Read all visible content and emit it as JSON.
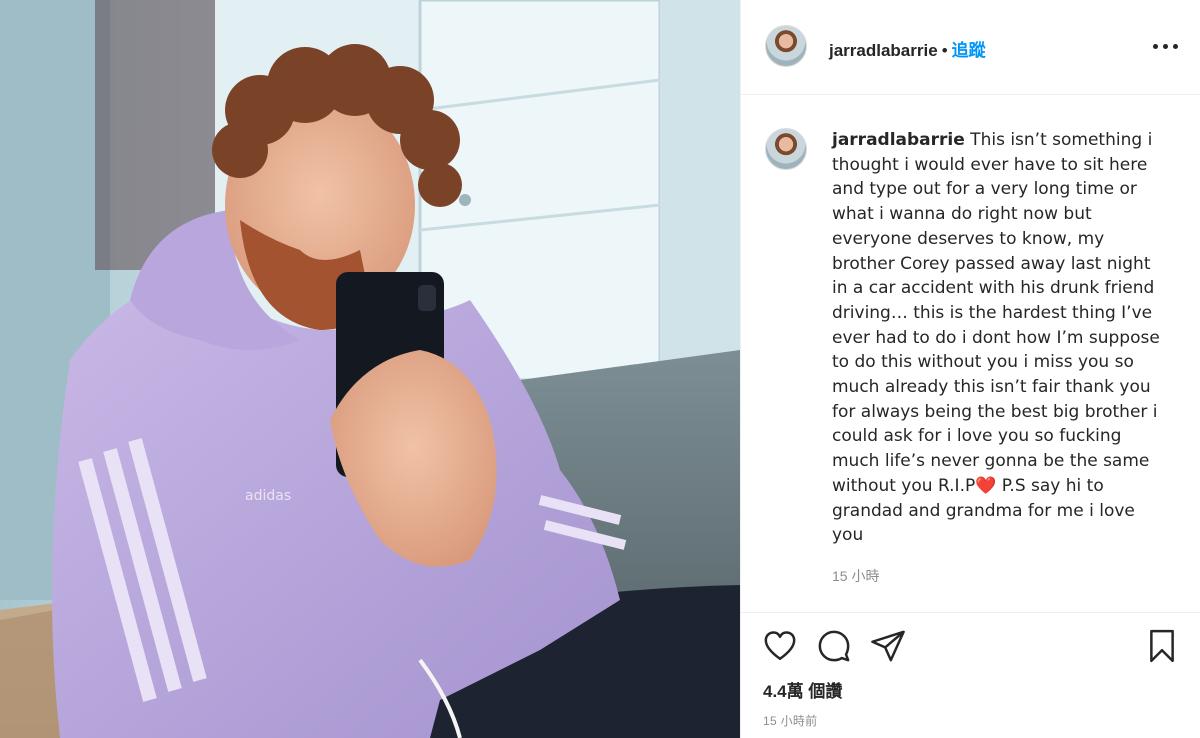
{
  "post": {
    "username": "jarradlabarrie",
    "separator": "•",
    "follow_label": "追蹤",
    "more_icon": "more-options-icon",
    "caption": {
      "username": "jarradlabarrie",
      "text_before_heart": " This isn’t something i thought i would ever have to sit here and type out for a very long time or what i wanna do right now but everyone deserves to know, my brother Corey passed away last night in a car accident with his drunk friend driving… this is the hardest thing I’ve ever had to do i dont how I’m suppose to do this without you i miss you so much already this isn’t fair thank you for always being the best big brother i could ask for i love you so fucking much life’s never gonna be the same without you R.I.P",
      "heart": "❤️",
      "text_after_heart": " P.S say hi to grandad and grandma for me i love you",
      "time": "15 小時"
    },
    "likes": "4.4萬 個讚",
    "posted_ago": "15 小時前",
    "icons": {
      "like": "heart-icon",
      "comment": "comment-icon",
      "share": "share-icon",
      "save": "bookmark-icon"
    },
    "accent_color": "#0095f6"
  }
}
